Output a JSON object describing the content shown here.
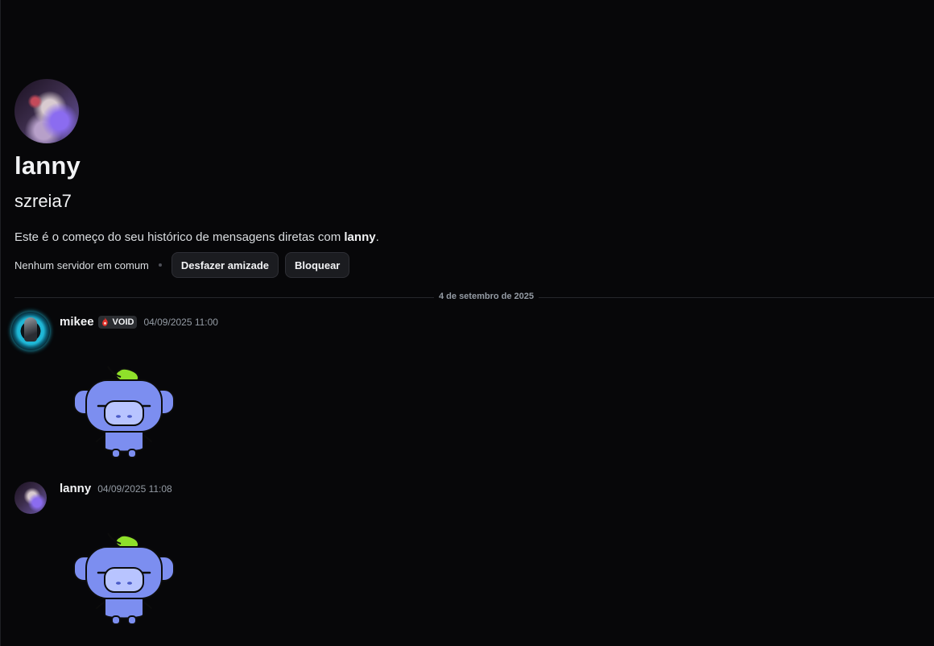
{
  "profile": {
    "display_name": "lanny",
    "username": "szreia7",
    "intro_prefix": "Este é o começo do seu histórico de mensagens diretas com ",
    "intro_name": "lanny",
    "intro_suffix": ".",
    "mutual_servers": "Nenhum servidor em comum",
    "unfriend_label": "Desfazer amizade",
    "block_label": "Bloquear"
  },
  "divider": {
    "date": "4 de setembro de 2025"
  },
  "messages": [
    {
      "author": "mikee",
      "tag": "VOID",
      "timestamp": "04/09/2025 11:00",
      "content": "wumpus-sticker"
    },
    {
      "author": "lanny",
      "timestamp": "04/09/2025 11:08",
      "content": "wumpus-sticker"
    }
  ],
  "colors": {
    "background": "#070709",
    "button_bg": "#1b1c20",
    "muted_text": "#949ba4",
    "wumpus": "#7c8ef0",
    "leaf": "#8fe02a",
    "tag_icon": "#e0312b"
  }
}
